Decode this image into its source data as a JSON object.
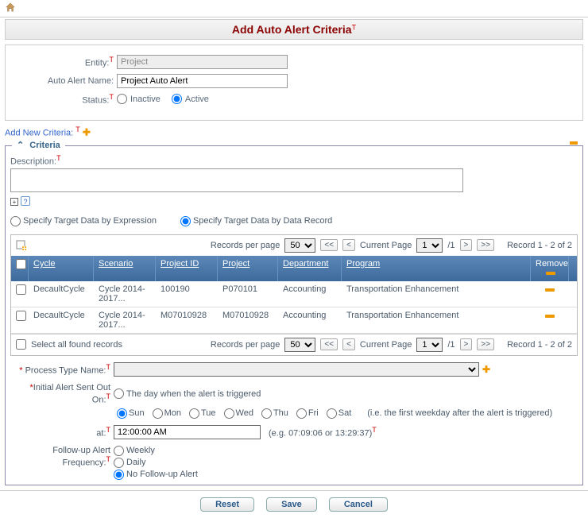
{
  "header": {
    "title": "Add Auto Alert Criteria"
  },
  "form": {
    "entity_label": "Entity:",
    "entity_value": "Project",
    "name_label": "Auto Alert Name:",
    "name_value": "Project Auto Alert",
    "status_label": "Status:",
    "status_inactive": "Inactive",
    "status_active": "Active"
  },
  "links": {
    "add_new": "Add New Criteria:"
  },
  "criteria": {
    "legend": "Criteria",
    "desc_label": "Description:",
    "target_expression": "Specify Target Data by Expression",
    "target_record": "Specify Target Data by Data Record",
    "records_per_page": "Records per page",
    "page_size": "50",
    "current_page_label": "Current Page",
    "current_page_value": "1",
    "total_pages": "/1",
    "record_range": "Record 1 - 2 of 2",
    "columns": {
      "cycle": "Cycle",
      "scenario": "Scenario",
      "project_id": "Project ID",
      "project": "Project",
      "department": "Department",
      "program": "Program",
      "remove": "Remove"
    },
    "rows": [
      {
        "cycle": "DecaultCycle",
        "scenario": "Cycle 2014-2017...",
        "project_id": "100190",
        "project": "P070101",
        "department": "Accounting",
        "program": "Transportation Enhancement"
      },
      {
        "cycle": "DecaultCycle",
        "scenario": "Cycle 2014-2017...",
        "project_id": "M07010928",
        "project": "M07010928",
        "department": "Accounting",
        "program": "Transportation Enhancement"
      }
    ],
    "select_all": "Select all found records",
    "process_type_label": "Process Type Name:",
    "initial_label": "Initial Alert Sent Out On:",
    "initial_trigger": "The day when the alert is triggered",
    "days": {
      "sun": "Sun",
      "mon": "Mon",
      "tue": "Tue",
      "wed": "Wed",
      "thu": "Thu",
      "fri": "Fri",
      "sat": "Sat"
    },
    "initial_hint": "(i.e. the first weekday after the alert is triggered)",
    "at_label": "at:",
    "at_value": "12:00:00 AM",
    "at_hint": "(e.g. 07:09:06 or 13:29:37)",
    "followup_label": "Follow-up Alert Frequency:",
    "followup_weekly": "Weekly",
    "followup_daily": "Daily",
    "followup_none": "No Follow-up Alert"
  },
  "footer": {
    "reset": "Reset",
    "save": "Save",
    "cancel": "Cancel"
  }
}
